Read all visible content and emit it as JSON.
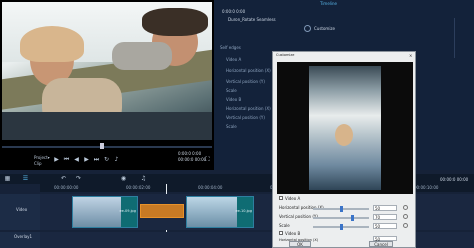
{
  "app_title": "Timeline",
  "preview": {
    "project_label": "Project▾",
    "clip_label": "Clip",
    "timecode_top": "0:00:0 0:00",
    "timecode_bottom": "00:00:0 00:00"
  },
  "options": {
    "timecode": "0:00:0 0:00",
    "effect_name": "Duron_Rotate Seamless",
    "customize_label": "Customize",
    "tree": {
      "self_edges": "Self edges",
      "video_a": "Video A",
      "video_b": "Video B",
      "horizontal_position": "Horizontal position (X)",
      "vertical_position": "Vertical position (Y)",
      "scale": "Scale"
    }
  },
  "dialog": {
    "title": "Customize",
    "video_a_label": "Video A",
    "video_b_label": "Video B",
    "horizontal_position": "Horizontal position (X)",
    "vertical_position": "Vertical position (Y)",
    "scale": "Scale",
    "a_h_value": "50",
    "a_v_value": "70",
    "a_scale_value": "50",
    "b_h_value": "50",
    "b_v_value": "23",
    "b_scale_value": "50",
    "ok_label": "OK",
    "cancel_label": "Cancel",
    "preview_caption": "Video A",
    "levels": {
      "a_h": 0.5,
      "a_v": 0.7,
      "a_scale": 0.5,
      "b_h": 0.5,
      "b_v": 0.23,
      "b_scale": 0.5
    }
  },
  "timeline": {
    "ruler": [
      "00:00:00:00",
      "00:00:02:00",
      "00:00:04:00",
      "00:00:06:00",
      "00:00:08:00",
      "00:00:10:00",
      "00:00:12:00",
      "00:00:14:00"
    ],
    "tracks": [
      "Video",
      "Overlay1"
    ],
    "clip1_label": "ee-09.jpg",
    "clip2_label": "ee-10.jpg"
  },
  "colors": {
    "accent": "#58b6e8",
    "transition": "#e8922a",
    "clip_border": "#2e7fa0"
  }
}
